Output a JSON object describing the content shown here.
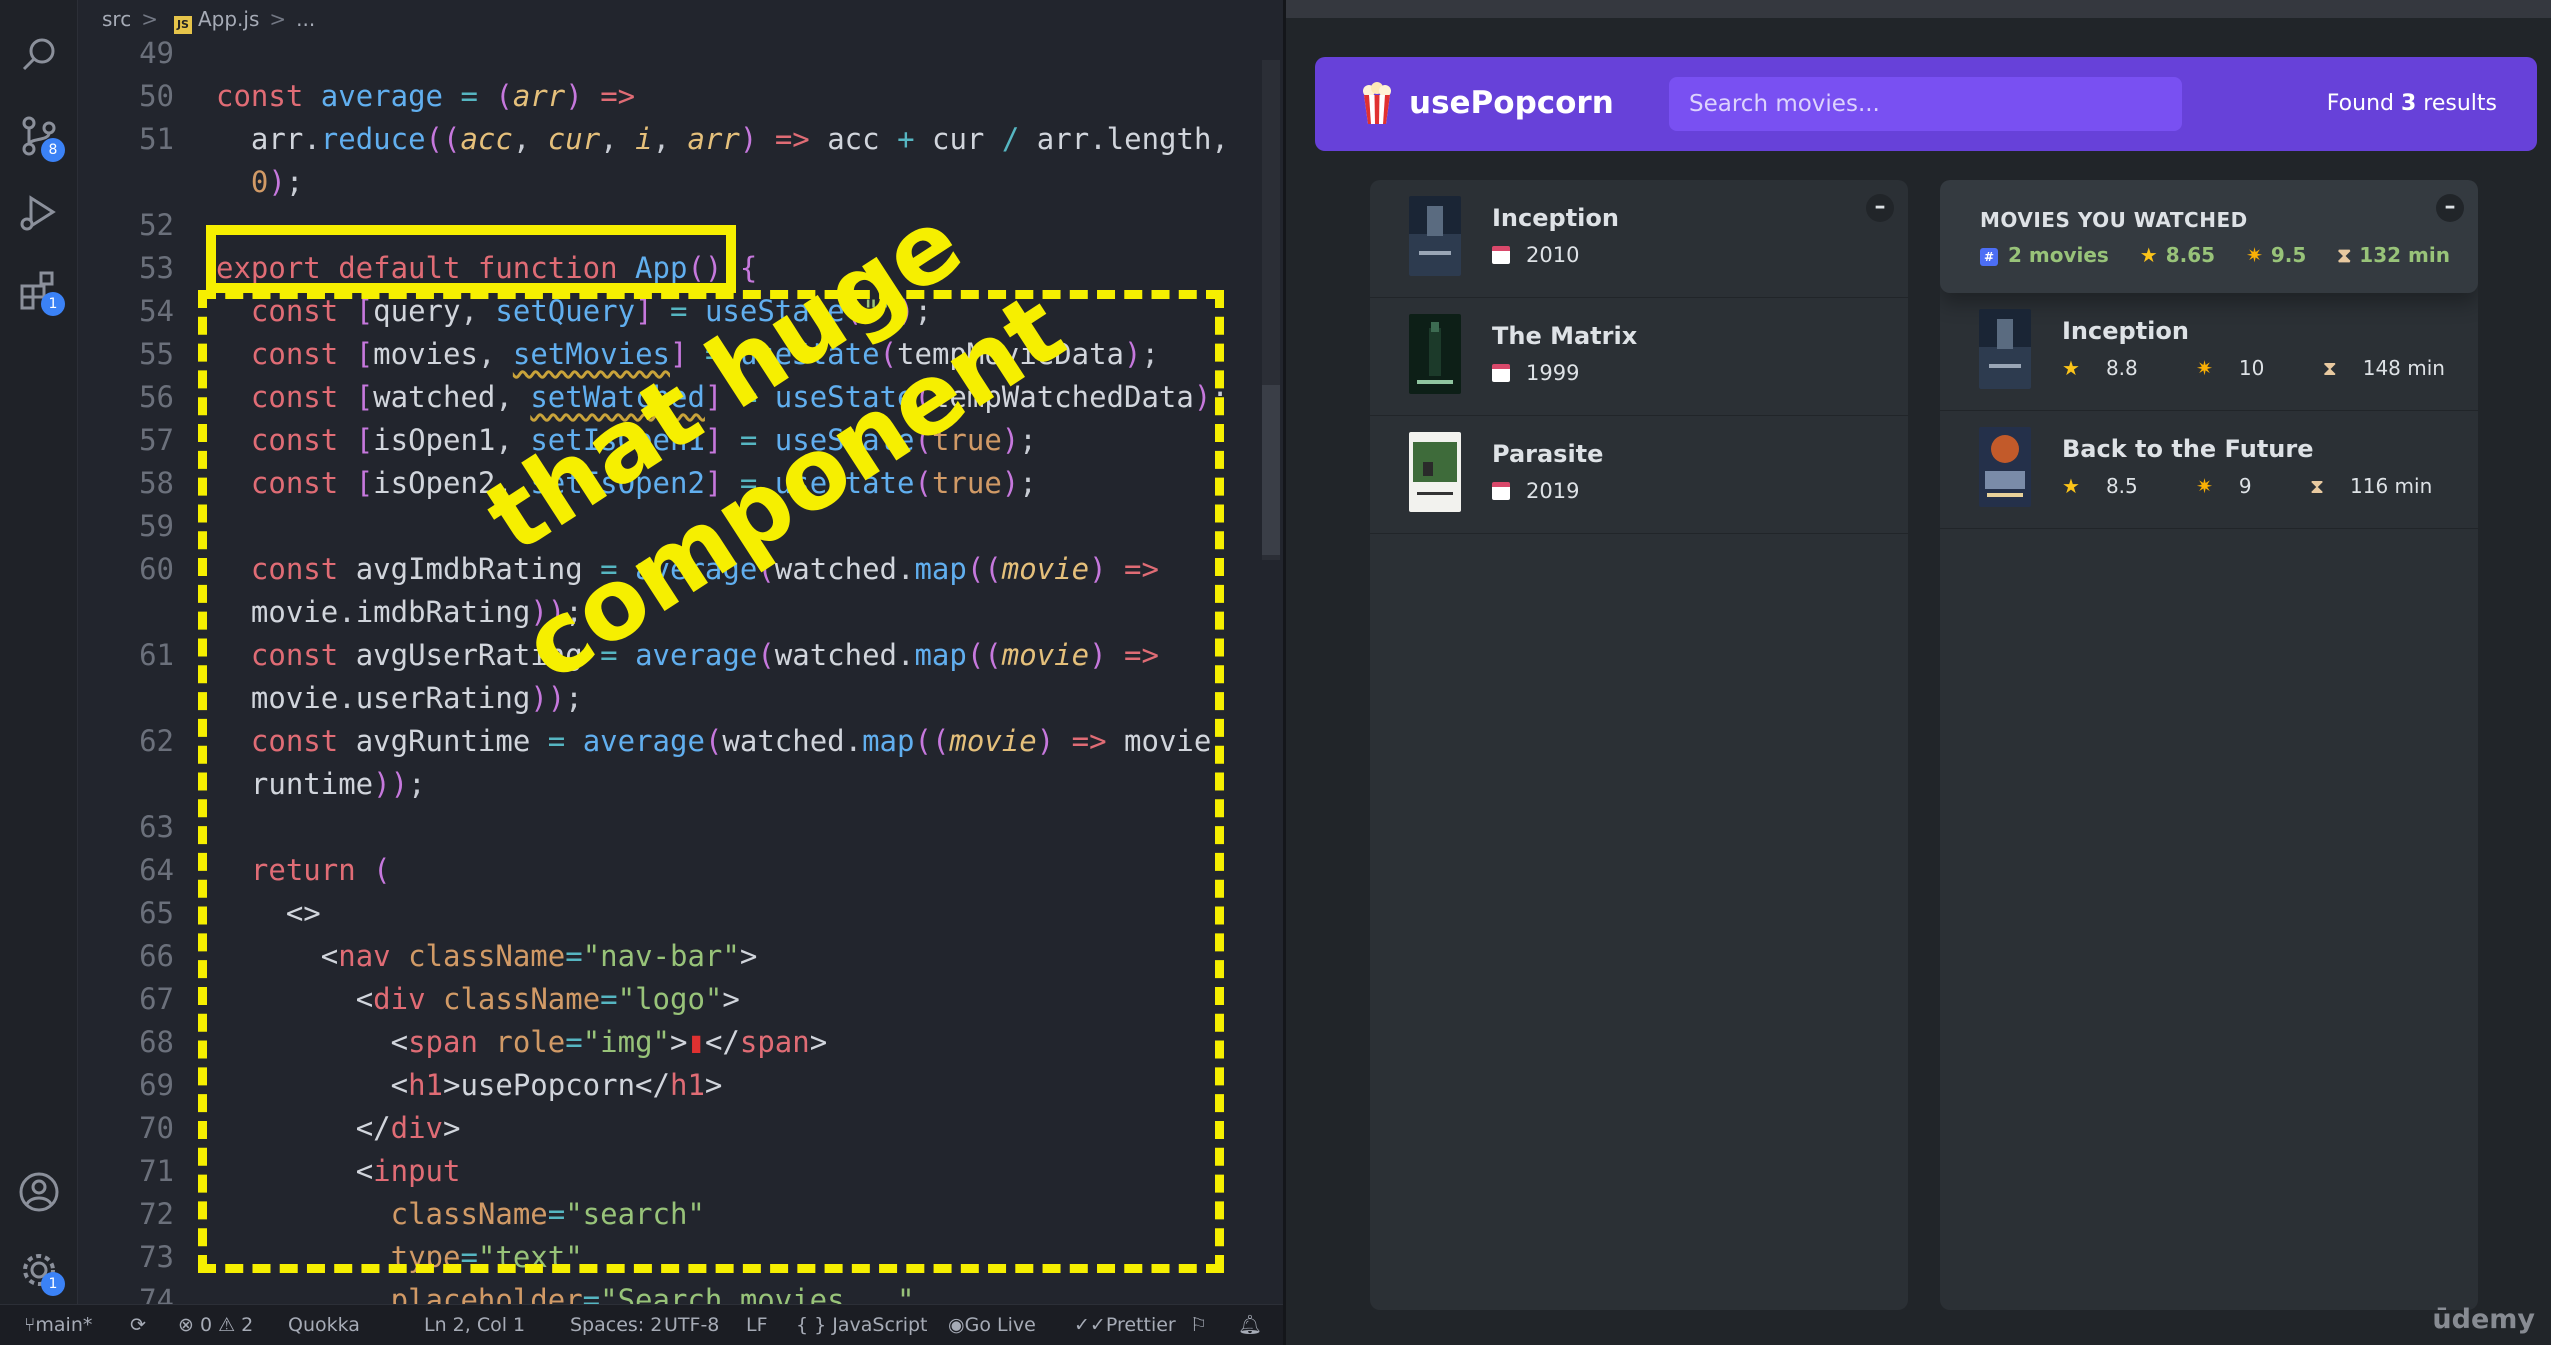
{
  "editor": {
    "breadcrumb": {
      "folder": "src",
      "file": "App.js",
      "symbol": "..."
    },
    "activity_badges": {
      "source_control": "8",
      "extensions": "1",
      "settings": "1"
    },
    "status": {
      "branch": "main*",
      "problems": "⊗ 0 ⚠ 2",
      "quokka": "Quokka",
      "position": "Ln 2, Col 1",
      "spaces": "Spaces: 2",
      "encoding": "UTF-8",
      "eol": "LF",
      "language": "{ } JavaScript",
      "golive": "Go Live",
      "prettier": "Prettier"
    },
    "annotation": {
      "line1": "that huge",
      "line2": "component"
    },
    "line_numbers": [
      "49",
      "50",
      "51",
      "",
      "52",
      "53",
      "54",
      "55",
      "56",
      "57",
      "58",
      "59",
      "60",
      "",
      "61",
      "",
      "62",
      "",
      "63",
      "64",
      "65",
      "66",
      "67",
      "68",
      "69",
      "70",
      "71",
      "72",
      "73",
      "74"
    ]
  },
  "app": {
    "logo_icon": "popcorn-icon",
    "logo_text": "usePopcorn",
    "search_placeholder": "Search movies...",
    "results_prefix": "Found",
    "results_count": "3",
    "results_suffix": "results",
    "toggle_label": "–",
    "movies": [
      {
        "title": "Inception",
        "year": "2010"
      },
      {
        "title": "The Matrix",
        "year": "1999"
      },
      {
        "title": "Parasite",
        "year": "2019"
      }
    ],
    "summary": {
      "title": "MOVIES YOU WATCHED",
      "count": "2 movies",
      "avg_imdb": "8.65",
      "avg_user": "9.5",
      "avg_runtime": "132 min"
    },
    "watched": [
      {
        "title": "Inception",
        "imdb": "8.8",
        "user": "10",
        "runtime": "148 min"
      },
      {
        "title": "Back to the Future",
        "imdb": "8.5",
        "user": "9",
        "runtime": "116 min"
      }
    ],
    "watermark": "ūdemy"
  },
  "colors": {
    "nav_bg": "#6741d9",
    "search_bg": "#7950f2",
    "box_bg": "#2b3035",
    "page_bg": "#212529",
    "highlight": "#f6ef00"
  }
}
